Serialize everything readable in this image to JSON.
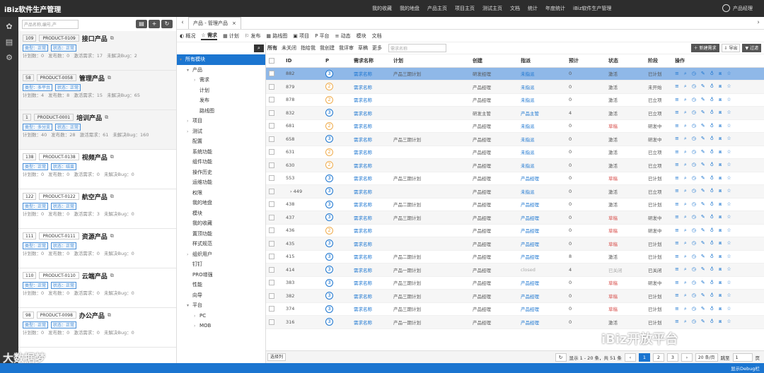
{
  "app": {
    "title": "iBiz软件生产管理"
  },
  "topnav": [
    "我的收藏",
    "我的地盘",
    "产品主页",
    "项目主页",
    "测试主页",
    "文档",
    "统计",
    "年度统计",
    "iBiz软件生产管理"
  ],
  "user": "产品经理",
  "product_search_placeholder": "产品名称,编号,产",
  "products": [
    {
      "num": "109",
      "code": "PRODUCT-0109",
      "name": "接口产品",
      "tags": [
        "类型：正常",
        "状态：正常"
      ],
      "stats": [
        "计划数：0",
        "发布数：0",
        "激活需求：17",
        "未解决Bug：2"
      ]
    },
    {
      "num": "58",
      "code": "PRODUCT-0058",
      "name": "管理产品",
      "tags": [
        "类型：多平台",
        "状态：正常"
      ],
      "stats": [
        "计划数：4",
        "发布数：8",
        "激活需求：15",
        "未解决Bug：65"
      ]
    },
    {
      "num": "1",
      "code": "PRODUCT-0001",
      "name": "培训产品",
      "tags": [
        "类型：多分支",
        "状态：正常"
      ],
      "stats": [
        "计划数：40",
        "发布数：28",
        "激活需求：61",
        "未解决Bug：160"
      ]
    },
    {
      "num": "138",
      "code": "PRODUCT-0138",
      "name": "视频产品",
      "tags": [
        "类型：正常",
        "状态：结束"
      ],
      "stats": [
        "计划数：0",
        "发布数：0",
        "激活需求：0",
        "未解决Bug：0"
      ]
    },
    {
      "num": "122",
      "code": "PRODUCT-0122",
      "name": "航空产品",
      "tags": [
        "类型：正常",
        "状态：正常"
      ],
      "stats": [
        "计划数：0",
        "发布数：0",
        "激活需求：3",
        "未解决Bug：0"
      ]
    },
    {
      "num": "111",
      "code": "PRODUCT-0111",
      "name": "资源产品",
      "tags": [
        "类型：正常",
        "状态：正常"
      ],
      "stats": [
        "计划数：0",
        "发布数：0",
        "激活需求：0",
        "未解决Bug：0"
      ]
    },
    {
      "num": "110",
      "code": "PRODUCT-0110",
      "name": "云端产品",
      "tags": [
        "类型：正常",
        "状态：正常"
      ],
      "stats": [
        "计划数：0",
        "发布数：0",
        "激活需求：0",
        "未解决Bug：0"
      ]
    },
    {
      "num": "98",
      "code": "PRODUCT-0098",
      "name": "办公产品",
      "tags": [
        "类型：正常",
        "状态：正常"
      ],
      "stats": [
        "计划数：0",
        "发布数：0",
        "激活需求：0",
        "未解决Bug：0"
      ]
    }
  ],
  "tab": {
    "label": "产品 - 管理产品",
    "close": "×"
  },
  "subnav": [
    "概况",
    "需求",
    "计划",
    "发布",
    "路线图",
    "项目",
    "平台",
    "动态",
    "模块",
    "文档"
  ],
  "tree": [
    {
      "label": "所有模块",
      "level": 0,
      "caret": "▾",
      "sel": true
    },
    {
      "label": "产品",
      "level": 1,
      "caret": "▾"
    },
    {
      "label": "需求",
      "level": 2,
      "caret": "›"
    },
    {
      "label": "计划",
      "level": 2,
      "caret": ""
    },
    {
      "label": "发布",
      "level": 2,
      "caret": ""
    },
    {
      "label": "路线图",
      "level": 2,
      "caret": ""
    },
    {
      "label": "项目",
      "level": 1,
      "caret": "›"
    },
    {
      "label": "测试",
      "level": 1,
      "caret": "›"
    },
    {
      "label": "配置",
      "level": 1,
      "caret": ""
    },
    {
      "label": "系统功能",
      "level": 1,
      "caret": ""
    },
    {
      "label": "组件功能",
      "level": 1,
      "caret": ""
    },
    {
      "label": "操作历史",
      "level": 1,
      "caret": ""
    },
    {
      "label": "运维功能",
      "level": 1,
      "caret": ""
    },
    {
      "label": "权限",
      "level": 1,
      "caret": ""
    },
    {
      "label": "我的地盘",
      "level": 1,
      "caret": ""
    },
    {
      "label": "模块",
      "level": 1,
      "caret": ""
    },
    {
      "label": "我的收藏",
      "level": 1,
      "caret": ""
    },
    {
      "label": "置顶功能",
      "level": 1,
      "caret": ""
    },
    {
      "label": "样式规范",
      "level": 1,
      "caret": ""
    },
    {
      "label": "组织用户",
      "level": 1,
      "caret": "›"
    },
    {
      "label": "钉钉",
      "level": 1,
      "caret": ""
    },
    {
      "label": "PRO增强",
      "level": 1,
      "caret": ""
    },
    {
      "label": "性能",
      "level": 1,
      "caret": ""
    },
    {
      "label": "向导",
      "level": 1,
      "caret": ""
    },
    {
      "label": "平台",
      "level": 1,
      "caret": "▾"
    },
    {
      "label": "PC",
      "level": 2,
      "caret": "›"
    },
    {
      "label": "MOB",
      "level": 2,
      "caret": "›"
    }
  ],
  "filters": [
    "所有",
    "未关闭",
    "指给我",
    "我创建",
    "我评审",
    "草稿",
    "更多"
  ],
  "story_search_placeholder": "需求名称",
  "actions": {
    "new": "新建需求",
    "export": "导出",
    "filter": "过滤"
  },
  "columns": [
    "ID",
    "P",
    "需求名称",
    "计划",
    "创建",
    "指派",
    "预计",
    "状态",
    "阶段",
    "操作"
  ],
  "rows": [
    {
      "id": "882",
      "p": "3",
      "name": "需求名称",
      "plan": "产品三期计划",
      "creator": "研发经理",
      "assignee": "未指派",
      "est": "0",
      "status": "激活",
      "stage": "已计划"
    },
    {
      "id": "879",
      "p": "2",
      "name": "需求名称",
      "plan": "",
      "creator": "产品经理",
      "assignee": "未指派",
      "est": "0",
      "status": "激活",
      "stage": "未开始"
    },
    {
      "id": "878",
      "p": "2",
      "name": "需求名称",
      "plan": "",
      "creator": "产品经理",
      "assignee": "未指派",
      "est": "0",
      "status": "激活",
      "stage": "已立项"
    },
    {
      "id": "832",
      "p": "3",
      "name": "需求名称",
      "plan": "",
      "creator": "研发主管",
      "assignee": "产品主管",
      "est": "4",
      "status": "激活",
      "stage": "已立项"
    },
    {
      "id": "681",
      "p": "2",
      "name": "需求名称",
      "plan": "",
      "creator": "产品经理",
      "assignee": "未指派",
      "est": "0",
      "status": "草稿",
      "stage": "研发中"
    },
    {
      "id": "658",
      "p": "3",
      "name": "需求名称",
      "plan": "产品三期计划",
      "creator": "产品经理",
      "assignee": "未指派",
      "est": "0",
      "status": "激活",
      "stage": "研发中"
    },
    {
      "id": "631",
      "p": "2",
      "name": "需求名称",
      "plan": "",
      "creator": "产品经理",
      "assignee": "未指派",
      "est": "0",
      "status": "激活",
      "stage": "已立项"
    },
    {
      "id": "630",
      "p": "2",
      "name": "需求名称",
      "plan": "",
      "creator": "产品经理",
      "assignee": "未指派",
      "est": "0",
      "status": "激活",
      "stage": "已立项"
    },
    {
      "id": "553",
      "p": "3",
      "name": "需求名称",
      "plan": "产品三期计划",
      "creator": "产品经理",
      "assignee": "产品经理",
      "est": "0",
      "status": "草稿",
      "stage": "已计划"
    },
    {
      "id": "449",
      "p": "3",
      "name": "需求名称",
      "plan": "",
      "creator": "产品经理",
      "assignee": "未指派",
      "est": "0",
      "status": "激活",
      "stage": "已立项"
    },
    {
      "id": "438",
      "p": "3",
      "name": "需求名称",
      "plan": "产品二期计划",
      "creator": "产品经理",
      "assignee": "产品经理",
      "est": "0",
      "status": "激活",
      "stage": "已计划"
    },
    {
      "id": "437",
      "p": "3",
      "name": "需求名称",
      "plan": "产品三期计划",
      "creator": "产品经理",
      "assignee": "产品经理",
      "est": "0",
      "status": "草稿",
      "stage": "研发中"
    },
    {
      "id": "436",
      "p": "2",
      "name": "需求名称",
      "plan": "",
      "creator": "产品经理",
      "assignee": "产品经理",
      "est": "0",
      "status": "草稿",
      "stage": "研发中"
    },
    {
      "id": "435",
      "p": "3",
      "name": "需求名称",
      "plan": "",
      "creator": "产品经理",
      "assignee": "产品经理",
      "est": "0",
      "status": "草稿",
      "stage": "已计划"
    },
    {
      "id": "415",
      "p": "3",
      "name": "需求名称",
      "plan": "产品二期计划",
      "creator": "产品经理",
      "assignee": "产品经理",
      "est": "8",
      "status": "激活",
      "stage": "已计划"
    },
    {
      "id": "414",
      "p": "3",
      "name": "需求名称",
      "plan": "产品一期计划",
      "creator": "产品经理",
      "assignee": "closed",
      "est": "4",
      "status": "已关闭",
      "stage": "已关闭"
    },
    {
      "id": "383",
      "p": "3",
      "name": "需求名称",
      "plan": "产品三期计划",
      "creator": "产品经理",
      "assignee": "产品经理",
      "est": "0",
      "status": "草稿",
      "stage": "研发中"
    },
    {
      "id": "382",
      "p": "3",
      "name": "需求名称",
      "plan": "产品三期计划",
      "creator": "产品经理",
      "assignee": "产品经理",
      "est": "0",
      "status": "草稿",
      "stage": "已计划"
    },
    {
      "id": "374",
      "p": "3",
      "name": "需求名称",
      "plan": "产品三期计划",
      "creator": "产品经理",
      "assignee": "产品经理",
      "est": "0",
      "status": "草稿",
      "stage": "已计划"
    },
    {
      "id": "316",
      "p": "3",
      "name": "需求名称",
      "plan": "产品一期计划",
      "creator": "产品经理",
      "assignee": "产品经理",
      "est": "0",
      "status": "激活",
      "stage": "已计划"
    }
  ],
  "bottom": {
    "choose_cols": "选择列",
    "summary": "显示 1 - 20 条，共 51 条",
    "pages": [
      "1",
      "2",
      "3"
    ],
    "page_size": "20 条/页",
    "goto": "跳至",
    "goto_val": "1",
    "page_unit": "页"
  },
  "status": "显示Debug栏",
  "watermark1": "iBiz开放平台",
  "watermark2": "大数据梦"
}
